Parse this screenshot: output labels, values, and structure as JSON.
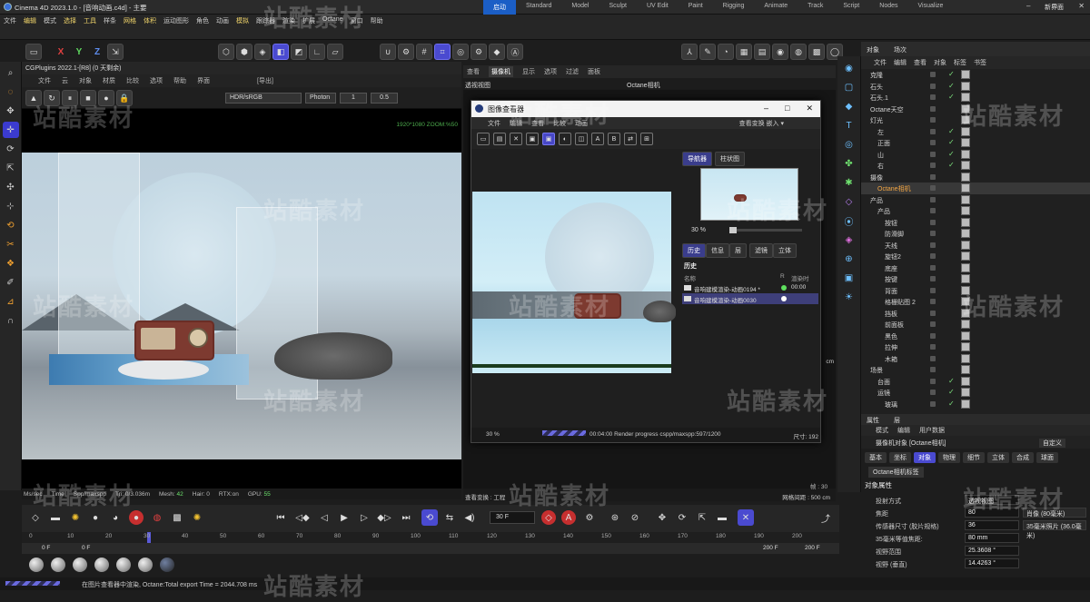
{
  "window": {
    "app_version": "Cinema 4D 2023.1.0",
    "file": "[音响动画.c4d]",
    "sep": " - ",
    "main": "主要"
  },
  "layout_tabs": [
    "启动",
    "Standard",
    "Model",
    "Sculpt",
    "UV Edit",
    "Paint",
    "Rigging",
    "Animate",
    "Track",
    "Script",
    "Nodes",
    "Visualize"
  ],
  "new_ui": "新界面",
  "menubar": [
    "文件",
    "编辑",
    "模式",
    "选择",
    "工具",
    "样条",
    "网格",
    "体积",
    "运动图形",
    "角色",
    "动画",
    "模拟",
    "跟踪器",
    "渲染",
    "扩展",
    "Octane",
    "窗口",
    "帮助"
  ],
  "left_viewport": {
    "title": "CGPlugins 2022.1-[R8] (0 天剩余)",
    "menu": [
      "文件",
      "云",
      "对象",
      "材质",
      "比较",
      "选项",
      "帮助",
      "界面"
    ],
    "export_label": "[导出]",
    "colorspace": "HDR/sRGB",
    "kernel": "Photon",
    "field1": "1",
    "field2": "0.5",
    "resolution": "1920*1080 ZOOM:%50",
    "status": {
      "ms": "Ms/sec",
      "time": "Time",
      "spp": "Spp/maxspp",
      "tri": "Tri: 0/3.036m",
      "mesh": "Mesh:",
      "mesh_val": "42",
      "hair": "Hair: 0",
      "rtx": "RTX:on",
      "gpu": "GPU:",
      "gpu_val": "55"
    }
  },
  "octane_view": {
    "menu": [
      "查看",
      "摄像机",
      "显示",
      "选项",
      "过滤",
      "面板"
    ],
    "active_menu": "摄像机",
    "bar_left": "透视视图",
    "bar_center": "Octane相机",
    "status_left": "查看变换 : 工程",
    "grid": "网格间距 : 500 cm",
    "frame_label": "帧 : 30",
    "side_label": "cm"
  },
  "picture_viewer": {
    "title": "图像查看器",
    "menu": [
      "文件",
      "编辑",
      "查看",
      "比较",
      "动画"
    ],
    "transform_label": "查看变换",
    "transform_value": "嵌入",
    "tabs": [
      "导航器",
      "柱状图"
    ],
    "zoom": "30 %",
    "section_tabs": [
      "历史",
      "信息",
      "层",
      "滤镜",
      "立体"
    ],
    "history_title": "历史",
    "history_cols": {
      "name": "名称",
      "r": "R",
      "time": "渲染时"
    },
    "history": [
      {
        "name": "音响建模渲染-动画0194 *",
        "time": "00:00"
      },
      {
        "name": "音响建模渲染-动画0030",
        "time": ""
      }
    ],
    "bottom_zoom": "30 %",
    "progress": "00:04:00 Render progress  cspp/maxspp:597/1200",
    "size_label": "尺寸: 192"
  },
  "objects_panel": {
    "tabs": [
      "对象",
      "场次"
    ],
    "menu": [
      "文件",
      "编辑",
      "查看",
      "对象",
      "标签",
      "书签"
    ],
    "items": [
      {
        "name": "克隆",
        "indent": 0,
        "has_check": true
      },
      {
        "name": "石头",
        "indent": 0,
        "has_check": true
      },
      {
        "name": "石头.1",
        "indent": 0,
        "has_check": true
      },
      {
        "name": "Octane天空",
        "indent": 0,
        "has_check": false
      },
      {
        "name": "灯光",
        "indent": 0,
        "has_check": false
      },
      {
        "name": "左",
        "indent": 1,
        "has_check": true
      },
      {
        "name": "正面",
        "indent": 1,
        "has_check": true
      },
      {
        "name": "山",
        "indent": 1,
        "has_check": true
      },
      {
        "name": "右",
        "indent": 1,
        "has_check": true
      },
      {
        "name": "摄像",
        "indent": 0,
        "has_check": false
      },
      {
        "name": "Octane相机",
        "indent": 1,
        "has_check": false,
        "orange": true
      },
      {
        "name": "产品",
        "indent": 0,
        "has_check": false
      },
      {
        "name": "产品",
        "indent": 1,
        "has_check": false
      },
      {
        "name": "按钮",
        "indent": 2,
        "has_check": false
      },
      {
        "name": "防滑脚",
        "indent": 2,
        "has_check": false
      },
      {
        "name": "天线",
        "indent": 2,
        "has_check": false
      },
      {
        "name": "旋钮2",
        "indent": 2,
        "has_check": false
      },
      {
        "name": "底座",
        "indent": 2,
        "has_check": false
      },
      {
        "name": "按键",
        "indent": 2,
        "has_check": false
      },
      {
        "name": "背面",
        "indent": 2,
        "has_check": false
      },
      {
        "name": "格栅贴图 2",
        "indent": 2,
        "has_check": false
      },
      {
        "name": "挡板",
        "indent": 2,
        "has_check": false
      },
      {
        "name": "前面板",
        "indent": 2,
        "has_check": false
      },
      {
        "name": "黑色",
        "indent": 2,
        "has_check": false
      },
      {
        "name": "拉伸",
        "indent": 2,
        "has_check": false
      },
      {
        "name": "木箱",
        "indent": 2,
        "has_check": false
      },
      {
        "name": "场景",
        "indent": 0,
        "has_check": false
      },
      {
        "name": "台面",
        "indent": 1,
        "has_check": true
      },
      {
        "name": "运镜",
        "indent": 1,
        "has_check": true
      },
      {
        "name": "玻璃",
        "indent": 2,
        "has_check": true
      }
    ]
  },
  "attributes": {
    "tabs": [
      "属性",
      "层"
    ],
    "menu": [
      "模式",
      "编辑",
      "用户数据"
    ],
    "object_label": "摄像机对象 [Octane相机]",
    "custom": "自定义",
    "attr_tabs": [
      "基本",
      "坐标",
      "对象",
      "物理",
      "细节",
      "立体",
      "合成",
      "球面"
    ],
    "active_tab": "对象",
    "extra_tab": "Octane相机标签",
    "section": "对象属性",
    "rows": [
      {
        "label": "投射方式",
        "value": "透视视图",
        "unit": ""
      },
      {
        "label": "焦距",
        "value": "80",
        "unit": "肖像 (80毫米)"
      },
      {
        "label": "传感器尺寸 (胶片规格)",
        "value": "36",
        "unit": "35毫米照片 (36.0毫米)"
      },
      {
        "label": "35毫米等值焦距:",
        "value": "80 mm",
        "unit": ""
      },
      {
        "label": "视野范围",
        "value": "25.3608 °",
        "unit": ""
      },
      {
        "label": "视野 (垂直)",
        "value": "14.4263 °",
        "unit": ""
      }
    ]
  },
  "timeline": {
    "frame": "30 F",
    "ruler": [
      "0",
      "10",
      "20",
      "30",
      "40",
      "50",
      "60",
      "70",
      "80",
      "90",
      "100",
      "110",
      "120",
      "130",
      "140",
      "150",
      "160",
      "170",
      "180",
      "190",
      "200"
    ],
    "range_start": "0 F",
    "range_start2": "0 F",
    "range_end": "200 F",
    "range_end2": "200 F"
  },
  "statusbar": "在图片查看器中渲染, Octane:Total export Time = 2044.708 ms",
  "watermark": "站酷素材",
  "colors": {
    "accent": "#1b5ec6",
    "selected_tool": "#4a4ad0",
    "green": "#6ce26c",
    "orange": "#f3a644"
  }
}
